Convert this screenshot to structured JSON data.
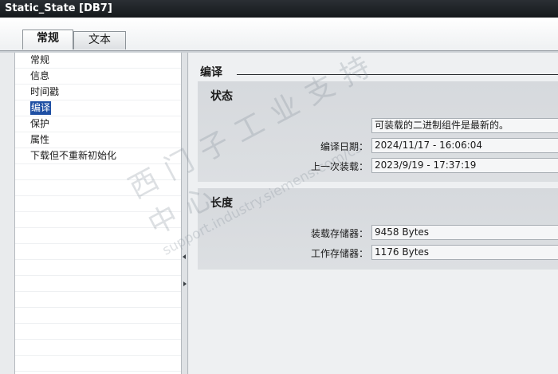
{
  "window": {
    "title": "Static_State [DB7]"
  },
  "tabs": [
    {
      "label": "常规",
      "active": true
    },
    {
      "label": "文本",
      "active": false
    }
  ],
  "nav": {
    "items": [
      {
        "label": "常规"
      },
      {
        "label": "信息"
      },
      {
        "label": "时间戳"
      },
      {
        "label": "编译",
        "selected": true
      },
      {
        "label": "保护"
      },
      {
        "label": "属性"
      },
      {
        "label": "下载但不重新初始化"
      }
    ]
  },
  "section": {
    "title": "编译"
  },
  "status_group": {
    "title": "状态",
    "message": "可装载的二进制组件是最新的。",
    "compile_date_label": "编译日期：",
    "compile_date_value": "2024/11/17 - 16:06:04",
    "last_load_label": "上一次装载：",
    "last_load_value": "2023/9/19 - 17:37:19"
  },
  "length_group": {
    "title": "长度",
    "load_memory_label": "装载存储器：",
    "load_memory_value": "9458 Bytes",
    "work_memory_label": "工作存储器：",
    "work_memory_value": "1176 Bytes"
  },
  "watermark": {
    "line1": "西门子工业支持中心",
    "line2": "support.industry.siemens.com/cs"
  },
  "colors": {
    "titlebar": "#15181b",
    "selection": "#1e4fa3",
    "group_bg": "#d6d9dd"
  }
}
